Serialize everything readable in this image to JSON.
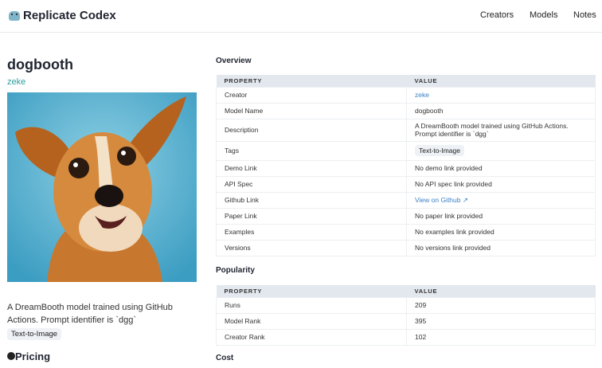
{
  "header": {
    "brand": "Replicate Codex",
    "nav": [
      "Creators",
      "Models",
      "Notes"
    ]
  },
  "model": {
    "name": "dogbooth",
    "creator": "zeke",
    "description": "A DreamBooth model trained using GitHub Actions. Prompt identifier is `dgg`",
    "tag": "Text-to-Image",
    "pricing_heading": "Pricing"
  },
  "overview": {
    "heading": "Overview",
    "col_property": "PROPERTY",
    "col_value": "VALUE",
    "rows": [
      {
        "p": "Creator",
        "v": "zeke"
      },
      {
        "p": "Model Name",
        "v": "dogbooth"
      },
      {
        "p": "Description",
        "v": "A DreamBooth model trained using GitHub Actions. Prompt identifier is `dgg`"
      },
      {
        "p": "Tags",
        "v": "Text-to-Image"
      },
      {
        "p": "Demo Link",
        "v": "No demo link provided"
      },
      {
        "p": "API Spec",
        "v": "No API spec link provided"
      },
      {
        "p": "Github Link",
        "v": "View on Github"
      },
      {
        "p": "Paper Link",
        "v": "No paper link provided"
      },
      {
        "p": "Examples",
        "v": "No examples link provided"
      },
      {
        "p": "Versions",
        "v": "No versions link provided"
      }
    ]
  },
  "popularity": {
    "heading": "Popularity",
    "col_property": "PROPERTY",
    "col_value": "VALUE",
    "rows": [
      {
        "p": "Runs",
        "v": "209"
      },
      {
        "p": "Model Rank",
        "v": "395"
      },
      {
        "p": "Creator Rank",
        "v": "102"
      }
    ]
  },
  "cost": {
    "heading": "Cost"
  }
}
